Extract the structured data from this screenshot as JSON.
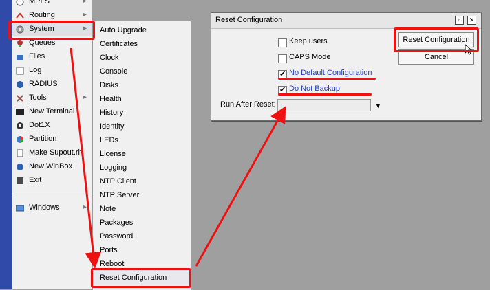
{
  "main_menu": {
    "items": [
      {
        "label": "MPLS",
        "icon": "mpls-icon",
        "arrow": true
      },
      {
        "label": "Routing",
        "icon": "routing-icon",
        "arrow": true
      },
      {
        "label": "System",
        "icon": "gear-icon",
        "arrow": true
      },
      {
        "label": "Queues",
        "icon": "queues-icon",
        "arrow": false
      },
      {
        "label": "Files",
        "icon": "files-icon",
        "arrow": false
      },
      {
        "label": "Log",
        "icon": "log-icon",
        "arrow": false
      },
      {
        "label": "RADIUS",
        "icon": "radius-icon",
        "arrow": false
      },
      {
        "label": "Tools",
        "icon": "tools-icon",
        "arrow": true
      },
      {
        "label": "New Terminal",
        "icon": "terminal-icon",
        "arrow": false
      },
      {
        "label": "Dot1X",
        "icon": "dot1x-icon",
        "arrow": false
      },
      {
        "label": "Partition",
        "icon": "partition-icon",
        "arrow": false
      },
      {
        "label": "Make Supout.rif",
        "icon": "supout-icon",
        "arrow": false
      },
      {
        "label": "New WinBox",
        "icon": "winbox-icon",
        "arrow": false
      },
      {
        "label": "Exit",
        "icon": "exit-icon",
        "arrow": false
      },
      {
        "label": "Windows",
        "icon": "windows-icon",
        "arrow": true
      }
    ],
    "arrow_glyph": "▸"
  },
  "system_submenu": {
    "items": [
      "Auto Upgrade",
      "Certificates",
      "Clock",
      "Console",
      "Disks",
      "Health",
      "History",
      "Identity",
      "LEDs",
      "License",
      "Logging",
      "NTP Client",
      "NTP Server",
      "Note",
      "Packages",
      "Password",
      "Ports",
      "Reboot",
      "Reset Configuration"
    ]
  },
  "dialog": {
    "title": "Reset Configuration",
    "options": [
      {
        "label": "Keep users",
        "checked": false,
        "highlight": false
      },
      {
        "label": "CAPS Mode",
        "checked": false,
        "highlight": false
      },
      {
        "label": "No Default Configuration",
        "checked": true,
        "highlight": true
      },
      {
        "label": "Do Not Backup",
        "checked": true,
        "highlight": true
      }
    ],
    "run_after_reset_label": "Run After Reset:",
    "run_after_reset_value": "",
    "reset_button": "Reset Configuration",
    "cancel_button": "Cancel",
    "check_glyph": "✔",
    "link_color": "#1f3fc6"
  },
  "colors": {
    "annotation": "#ee1111",
    "sidebar_strip": "#2f4aa8"
  }
}
